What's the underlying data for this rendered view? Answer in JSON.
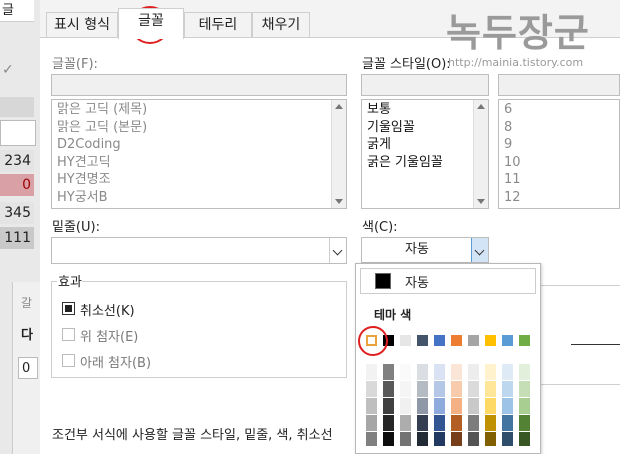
{
  "background_sheet": {
    "tab_label": "글",
    "cells": [
      "234",
      "0",
      "345",
      "111"
    ],
    "sub_dialog_labels": [
      "갈",
      "다",
      "0"
    ]
  },
  "tabs": [
    {
      "label": "표시 형식"
    },
    {
      "label": "글꼴"
    },
    {
      "label": "테두리"
    },
    {
      "label": "채우기"
    }
  ],
  "font": {
    "label": "글꼴(F):",
    "items": [
      "맑은 고딕 (제목)",
      "맑은 고딕 (본문)",
      "D2Coding",
      "HY견고딕",
      "HY견명조",
      "HY궁서B"
    ]
  },
  "font_style": {
    "label": "글꼴 스타일(O):",
    "items": [
      "보통",
      "기울임꼴",
      "굵게",
      "굵은 기울임꼴"
    ]
  },
  "size": {
    "items": [
      "6",
      "8",
      "9",
      "10",
      "11",
      "12"
    ]
  },
  "underline": {
    "label": "밑줄(U):"
  },
  "color": {
    "label": "색(C):",
    "value": "자동"
  },
  "effects": {
    "label": "효과",
    "items": [
      {
        "label": "취소선(K)",
        "checked": true
      },
      {
        "label": "위 첨자(E)",
        "checked": false
      },
      {
        "label": "아래 첨자(B)",
        "checked": false
      }
    ]
  },
  "footer_note": "조건부 서식에 사용할 글꼴 스타일, 밑줄, 색, 취소선",
  "color_popup": {
    "auto_label": "자동",
    "theme_label": "테마 색",
    "theme_colors": [
      "#ffffff",
      "#000000",
      "#e7e6e6",
      "#44546a",
      "#4472c4",
      "#ed7d31",
      "#a5a5a5",
      "#ffc000",
      "#5b9bd5",
      "#70ad47"
    ]
  },
  "watermark": {
    "title": "녹두장군",
    "url": "http://mainia.tistory.com"
  }
}
